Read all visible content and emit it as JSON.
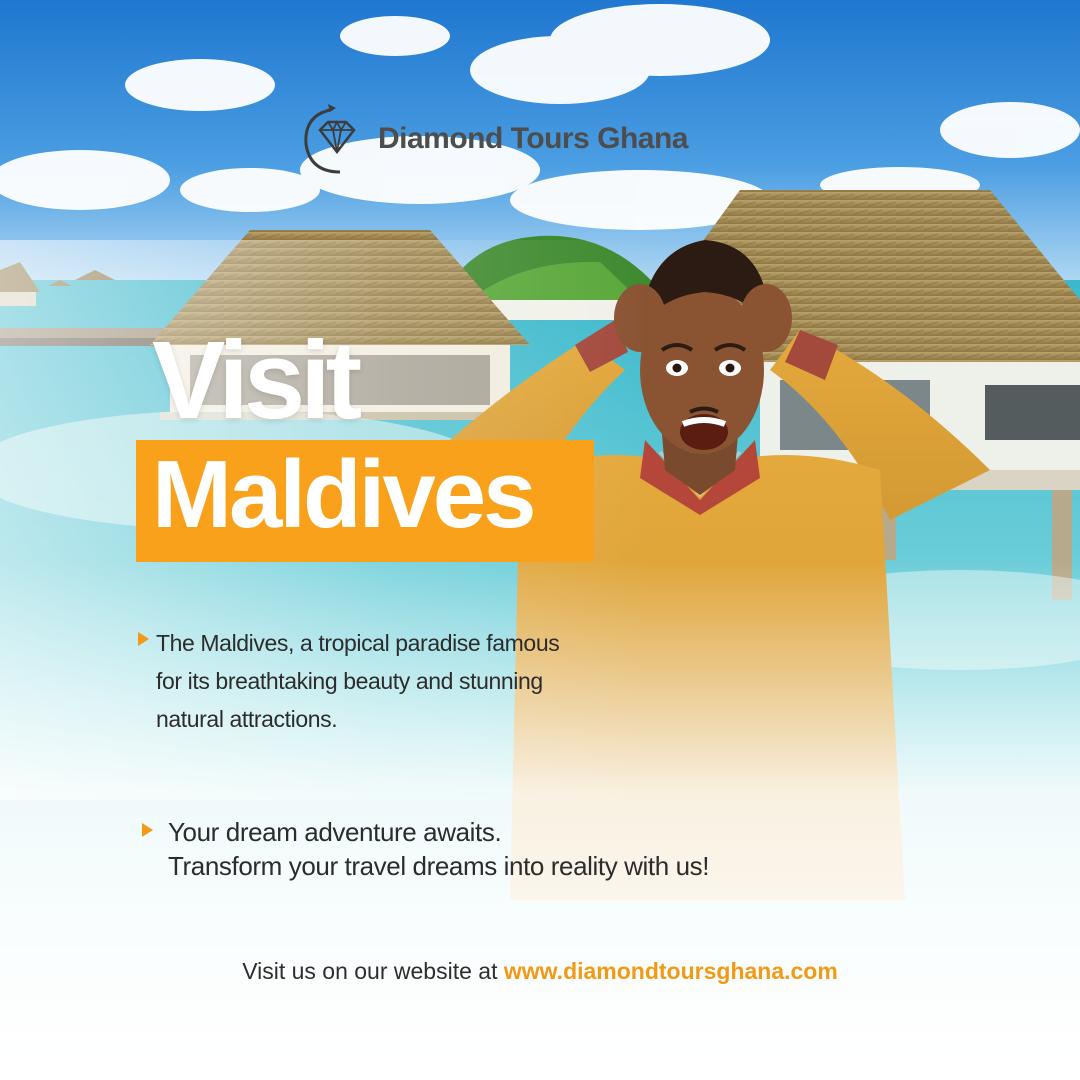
{
  "brand": {
    "name": "Diamond Tours Ghana",
    "logo_icon": "diamond-with-airplane-icon"
  },
  "headline": {
    "line1": "Visit",
    "line2": "Maldives"
  },
  "bullets": [
    {
      "icon": "triangle-bullet-icon",
      "lines": [
        "The Maldives, a tropical paradise famous",
        "for its breathtaking beauty and stunning",
        "natural attractions."
      ]
    },
    {
      "icon": "triangle-bullet-icon",
      "lines": [
        "Your dream adventure awaits.",
        "Transform your travel dreams into reality with us!"
      ]
    }
  ],
  "footer": {
    "prefix": "Visit us on our website at",
    "url": "www.diamondtoursghana.com"
  },
  "colors": {
    "accent": "#f9a11b",
    "brand_text": "#4d4d4d",
    "body_text": "#2c2c2c",
    "sky": "#2f86d6",
    "lagoon": "#54c6d4",
    "thatch": "#a58f5a",
    "sweater": "#e3a83c"
  }
}
